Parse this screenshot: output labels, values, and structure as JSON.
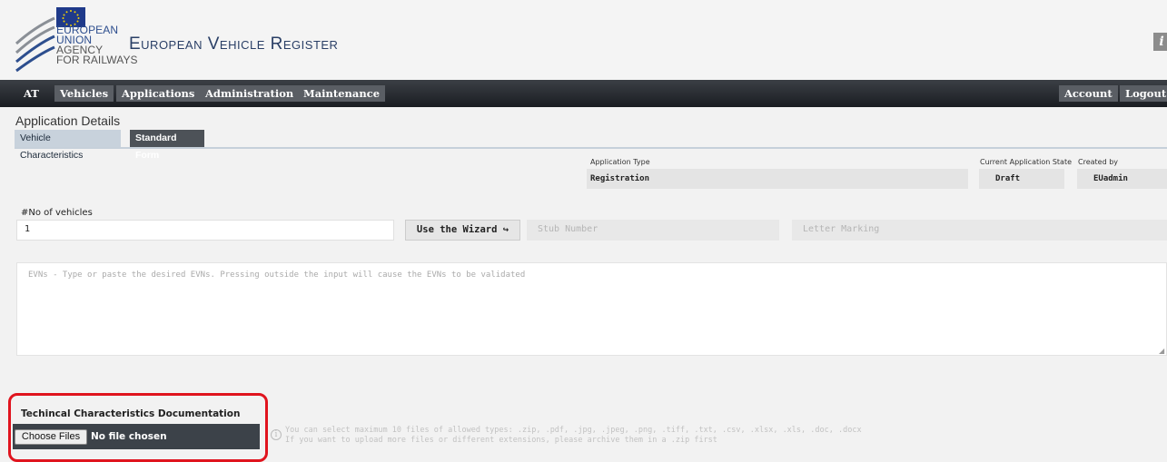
{
  "header": {
    "logo_lines": [
      "EUROPEAN",
      "UNION",
      "AGENCY",
      "FOR RAILWAYS"
    ],
    "title": "European Vehicle Register",
    "info_glyph": "i"
  },
  "nav": {
    "items": [
      "AT",
      "Vehicles",
      "Applications",
      "Administration",
      "Maintenance"
    ],
    "right_items": [
      "Account",
      "Logout"
    ]
  },
  "page": {
    "section_title": "Application Details",
    "tabs": [
      "Vehicle Characteristics",
      "Standard Form"
    ]
  },
  "application": {
    "type_label": "Application Type",
    "type_value": "Registration",
    "state_label": "Current Application State",
    "state_value": "Draft",
    "created_label": "Created by",
    "created_value": "EUadmin"
  },
  "vehicles": {
    "count_label": "#No of vehicles",
    "count_value": "1",
    "wizard_label": "Use the Wizard ↪",
    "stub_placeholder": "Stub Number",
    "letter_placeholder": "Letter Marking",
    "evn_placeholder": "EVNs - Type or paste the desired EVNs. Pressing outside the input will cause the EVNs to be validated"
  },
  "documents": {
    "title": "Techincal Characteristics Documentation",
    "choose_label": "Choose Files",
    "no_file": "No file chosen",
    "hint_line1": "You can select maximum 10 files of allowed types: .zip, .pdf, .jpg, .jpeg, .png, .tiff, .txt, .csv, .xlsx, .xls, .doc, .docx",
    "hint_line2": "If you want to upload more files or different extensions, please archive them in a .zip first"
  },
  "colors": {
    "highlight": "#e0141e",
    "nav_bg": "#1a1d22",
    "brand_blue": "#2d4e8e"
  }
}
